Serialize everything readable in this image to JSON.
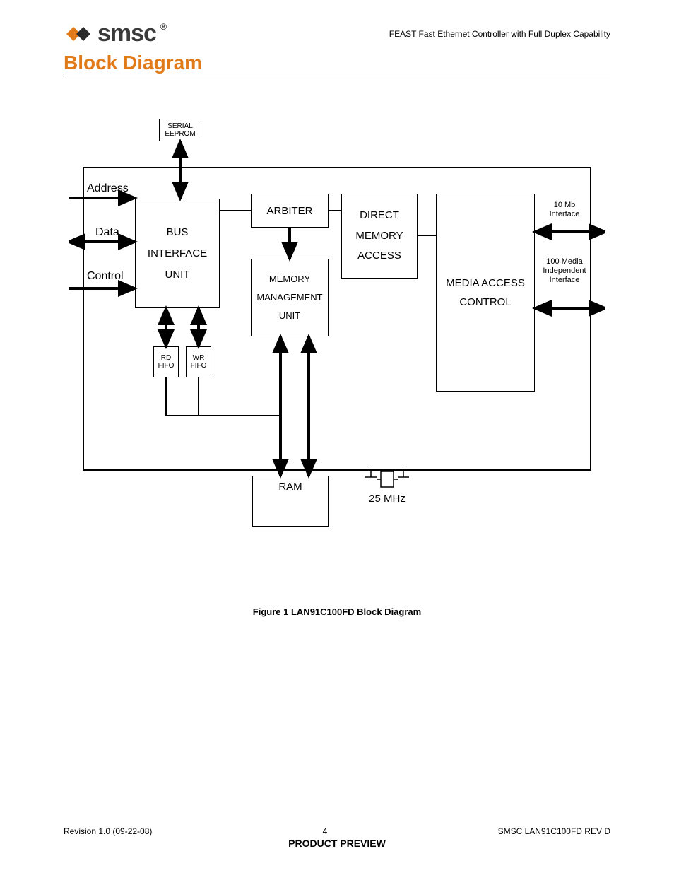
{
  "header": {
    "brand": "smsc",
    "registered": "®",
    "subtitle": "FEAST Fast Ethernet Controller with Full Duplex Capability"
  },
  "section_title": "Block Diagram",
  "figure_caption": "Figure 1  LAN91C100FD Block Diagram",
  "io_labels": {
    "address": "Address",
    "data": "Data",
    "control": "Control"
  },
  "right_labels": {
    "ten_mb": "10 Mb Interface",
    "hundred": "100 Media Independent Interface"
  },
  "blocks": {
    "serial_eeprom": "SERIAL EEPROM",
    "bus_interface_unit": "BUS INTERFACE UNIT",
    "arbiter": "ARBITER",
    "direct_memory_access": "DIRECT MEMORY ACCESS",
    "memory_management_unit": "MEMORY MANAGEMENT UNIT",
    "media_access_control": "MEDIA ACCESS CONTROL",
    "rd_fifo": "RD FIFO",
    "wr_fifo": "WR FIFO",
    "ram": "RAM",
    "clock": "25 MHz"
  },
  "footer": {
    "revision": "Revision 1.0 (09-22-08)",
    "page": "4",
    "right": "SMSC LAN91C100FD REV D",
    "preview": "PRODUCT PREVIEW"
  }
}
